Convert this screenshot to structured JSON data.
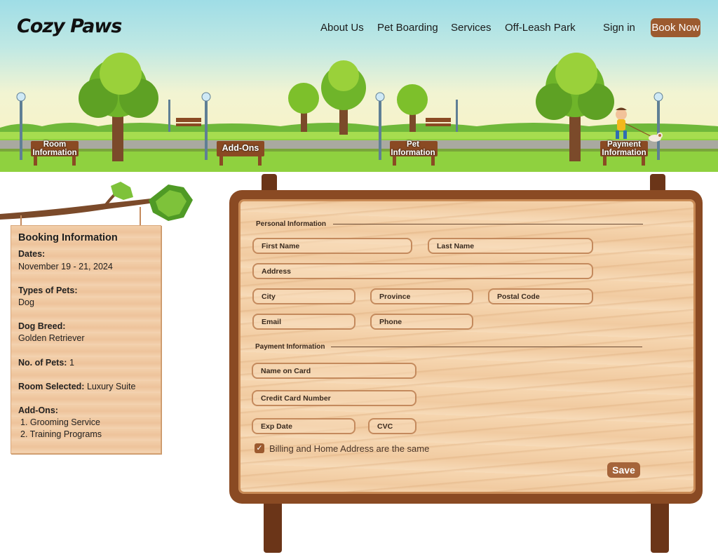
{
  "header": {
    "logo": "Cozy Paws",
    "nav": [
      "About Us",
      "Pet Boarding",
      "Services",
      "Off-Leash Park"
    ],
    "sign_in": "Sign in",
    "book_now": "Book Now"
  },
  "steps": {
    "room": "Room Information",
    "addons": "Add-Ons",
    "pet": "Pet Information",
    "payment": "Payment Information"
  },
  "booking": {
    "title": "Booking Information",
    "dates_label": "Dates:",
    "dates_value": "November 19 - 21, 2024",
    "types_label": "Types of Pets:",
    "types_value": "Dog",
    "breed_label": "Dog Breed:",
    "breed_value": "Golden Retriever",
    "count_label": "No. of Pets:",
    "count_value": "1",
    "room_label": "Room Selected:",
    "room_value": "Luxury Suite",
    "addons_label": "Add-Ons:",
    "addons": [
      "1. Grooming Service",
      "2. Training Programs"
    ]
  },
  "form": {
    "personal_title": "Personal Information",
    "payment_title": "Payment Information",
    "first_name": "First Name",
    "last_name": "Last Name",
    "address": "Address",
    "city": "City",
    "province": "Province",
    "postal_code": "Postal Code",
    "email": "Email",
    "phone": "Phone",
    "name_on_card": "Name on Card",
    "card_number": "Credit Card Number",
    "exp_date": "Exp Date",
    "cvc": "CVC",
    "same_address": "Billing and Home Address are the same",
    "same_address_checked": true,
    "save": "Save"
  },
  "colors": {
    "brand_brown": "#9c5a2f",
    "sky": "#9fdde6",
    "grass": "#8fd13f",
    "wood_light": "#f3d3b1",
    "wood_dark": "#8a4a23"
  }
}
